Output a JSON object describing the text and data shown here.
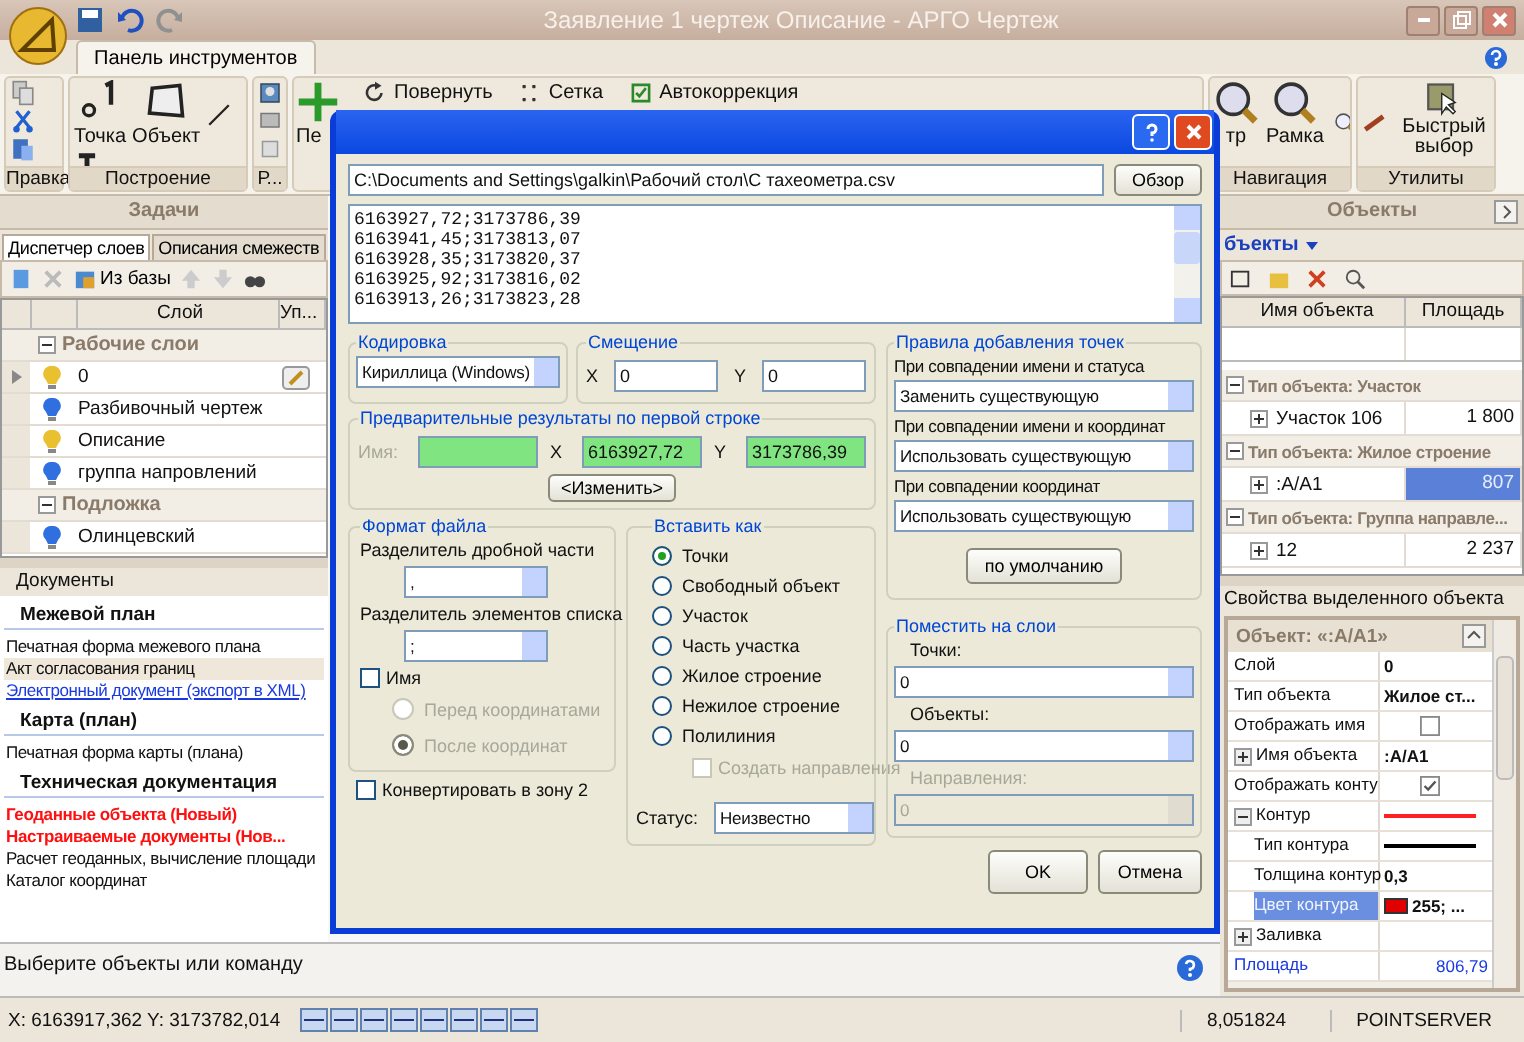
{
  "window": {
    "title": "Заявление 1 чертеж Описание - АРГО Чертеж"
  },
  "ribbon": {
    "tabs": [
      {
        "label": "Панель инструментов",
        "selected": true
      }
    ],
    "groups": [
      {
        "label": "Правка",
        "buttons": [
          {
            "kind": "copy"
          },
          {
            "kind": "cut"
          },
          {
            "kind": "paste"
          }
        ]
      },
      {
        "label": "Построение",
        "buttons": [
          {
            "kind": "point",
            "label": "Точка"
          },
          {
            "kind": "object",
            "label": "Объект"
          },
          {
            "kind": "line"
          },
          {
            "kind": "text"
          }
        ]
      },
      {
        "label": "Р...",
        "buttons": [
          {
            "kind": "image"
          },
          {
            "kind": "monitor"
          },
          {
            "kind": "frame"
          }
        ]
      },
      {
        "buttons": [
          {
            "kind": "move",
            "label": "Пе"
          },
          {
            "kind": "rotate",
            "label": "Повернуть"
          },
          {
            "kind": "grid",
            "label": "Сетка"
          },
          {
            "kind": "autocorrect",
            "label": "Автокоррекция"
          }
        ]
      },
      {
        "label": "Навигация",
        "buttons": [
          {
            "kind": "zoom-extents",
            "label": "тр"
          },
          {
            "kind": "zoom-window",
            "label": "Рамка"
          },
          {
            "kind": "zoom-in"
          }
        ]
      },
      {
        "label": "Утилиты",
        "buttons": [
          {
            "kind": "measure"
          },
          {
            "kind": "quick-select",
            "label": "Быстрый выбор"
          }
        ]
      }
    ]
  },
  "tasks": {
    "title": "Задачи",
    "tabs": [
      {
        "label": "Диспетчер слоев",
        "selected": true
      },
      {
        "label": "Описания смежеств",
        "selected": false
      }
    ],
    "toolbar_button": "Из базы",
    "columns": [
      "Слой",
      "Уп..."
    ],
    "groups": [
      {
        "label": "Рабочие слои",
        "expanded": true,
        "children": [
          {
            "name": "0",
            "color": "#e8c030",
            "selected": true
          },
          {
            "name": "Разбивочный чертеж",
            "color": "#2f6fe0",
            "selected": false
          },
          {
            "name": "Описание",
            "color": "#e8c030",
            "selected": false
          },
          {
            "name": "группа напровлений",
            "color": "#2f6fe0",
            "selected": false
          }
        ]
      },
      {
        "label": "Подложка",
        "expanded": true,
        "children": [
          {
            "name": "Олинцевский",
            "color": "#2f6fe0",
            "selected": false
          }
        ]
      }
    ]
  },
  "documents": {
    "title": "Документы",
    "sections": [
      {
        "title": "Межевой план",
        "items": [
          {
            "label": "Печатная форма межевого плана",
            "kind": "plain",
            "selected": false
          },
          {
            "label": "Акт согласования границ",
            "kind": "plain",
            "selected": true
          },
          {
            "label": "Электронный документ (экспорт в XML)",
            "kind": "link",
            "selected": false
          }
        ]
      },
      {
        "title": "Карта (план)",
        "items": [
          {
            "label": "Печатная форма карты (плана)",
            "kind": "plain",
            "selected": false
          }
        ]
      },
      {
        "title": "Техническая документация",
        "items": [
          {
            "label": "Геоданные объекта (Новый)",
            "kind": "new",
            "selected": false
          },
          {
            "label": "Настраиваемые документы (Нов...",
            "kind": "new",
            "selected": false
          },
          {
            "label": "Расчет геоданных, вычисление площади",
            "kind": "plain",
            "selected": false
          },
          {
            "label": "Каталог координат",
            "kind": "plain",
            "selected": false
          }
        ]
      }
    ]
  },
  "objects": {
    "title": "Объекты",
    "selector": "бъекты",
    "columns": [
      "Имя объекта",
      "Площадь"
    ],
    "groups": [
      {
        "label": "Тип объекта: Участок",
        "expanded": true,
        "children": [
          {
            "name": "Участок 106",
            "area": "1 800",
            "selected": false
          }
        ]
      },
      {
        "label": "Тип объекта: Жилое строение",
        "expanded": true,
        "children": [
          {
            "name": ":A/A1",
            "area": "807",
            "selected": true
          }
        ]
      },
      {
        "label": "Тип объекта: Группа направле...",
        "expanded": true,
        "children": [
          {
            "name": "12",
            "area": "2 237",
            "selected": false
          }
        ]
      }
    ]
  },
  "properties": {
    "title": "Свойства выделенного объекта",
    "header": "Объект: «:A/A1»",
    "rows": [
      {
        "label": "Слой",
        "kind": "text",
        "value": "0"
      },
      {
        "label": "Тип объекта",
        "kind": "text",
        "value": "Жилое ст..."
      },
      {
        "label": "Отображать имя",
        "kind": "check",
        "checked": false
      },
      {
        "label": "Имя объекта",
        "kind": "text",
        "value": ":A/A1",
        "expanded": false
      },
      {
        "label": "Отображать конту",
        "kind": "check",
        "checked": true
      },
      {
        "label": "Контур",
        "kind": "line",
        "color": "#ff2020",
        "expanded": true,
        "children": [
          {
            "label": "Тип контура",
            "kind": "line",
            "color": "#000000"
          },
          {
            "label": "Толщина контур",
            "kind": "text",
            "value": "0,3"
          },
          {
            "label": "Цвет контура",
            "kind": "color",
            "color": "#e00000",
            "value": "255; ...",
            "selected": true
          }
        ]
      },
      {
        "label": "Заливка",
        "kind": "empty",
        "expanded": false
      },
      {
        "label": "Площадь",
        "kind": "link",
        "value": "806,79"
      }
    ]
  },
  "command_line": {
    "prompt": "Выберите объекты или команду"
  },
  "status_bar": {
    "coordinates": "X: 6163917,362 Y: 3173782,014",
    "scale": "8,051824",
    "server": "POINTSERVER"
  },
  "dialog": {
    "file_path": "C:\\Documents and Settings\\galkin\\Рабочий стол\\С тахеометра.csv",
    "browse_button": "Обзор",
    "preview_lines": [
      "6163927,72;3173786,39",
      "6163941,45;3173813,07",
      "6163928,35;3173820,37",
      "6163925,92;3173816,02",
      "6163913,26;3173823,28"
    ],
    "encoding": {
      "label": "Кодировка",
      "value": "Кириллица (Windows)"
    },
    "offset": {
      "label": "Смещение",
      "x_label": "X",
      "x_value": "0",
      "y_label": "Y",
      "y_value": "0"
    },
    "preview": {
      "label": "Предварительные результаты по первой строке",
      "name_label": "Имя:",
      "x_label": "X",
      "x_value": "6163927,72",
      "y_label": "Y",
      "y_value": "3173786,39",
      "change_button": "<Изменить>"
    },
    "rules": {
      "label": "Правила добавления точек",
      "items": [
        {
          "label": "При совпадении имени и статуса",
          "value": "Заменить существующую"
        },
        {
          "label": "При совпадении имени и координат",
          "value": "Использовать существующую"
        },
        {
          "label": "При совпадении координат",
          "value": "Использовать существующую"
        }
      ],
      "default_button": "по умолчанию"
    },
    "file_format": {
      "label": "Формат файла",
      "decimal_label": "Разделитель дробной части",
      "decimal_value": ",",
      "list_label": "Разделитель элементов списка",
      "list_value": ";",
      "name_checkbox": {
        "label": "Имя",
        "checked": false
      },
      "position": [
        {
          "label": "Перед координатами",
          "selected": false,
          "disabled": true
        },
        {
          "label": "После координат",
          "selected": true,
          "disabled": true
        }
      ]
    },
    "convert": {
      "label": "Конвертировать в зону 2",
      "checked": false
    },
    "insert_as": {
      "label": "Вставить как",
      "options": [
        {
          "label": "Точки",
          "selected": true
        },
        {
          "label": "Свободный объект",
          "selected": false
        },
        {
          "label": "Участок",
          "selected": false
        },
        {
          "label": "Часть участка",
          "selected": false
        },
        {
          "label": "Жилое строение",
          "selected": false
        },
        {
          "label": "Нежилое строение",
          "selected": false
        },
        {
          "label": "Полилиния",
          "selected": false
        }
      ],
      "create_directions": {
        "label": "Создать направления",
        "checked": false,
        "disabled": true
      },
      "status_label": "Статус:",
      "status_value": "Неизвестно"
    },
    "layers": {
      "label": "Поместить на слои",
      "fields": [
        {
          "label": "Точки:",
          "value": "0",
          "disabled": false
        },
        {
          "label": "Объекты:",
          "value": "0",
          "disabled": false
        },
        {
          "label": "Направления:",
          "value": "0",
          "disabled": true
        }
      ]
    },
    "ok_button": "OK",
    "cancel_button": "Отмена"
  }
}
